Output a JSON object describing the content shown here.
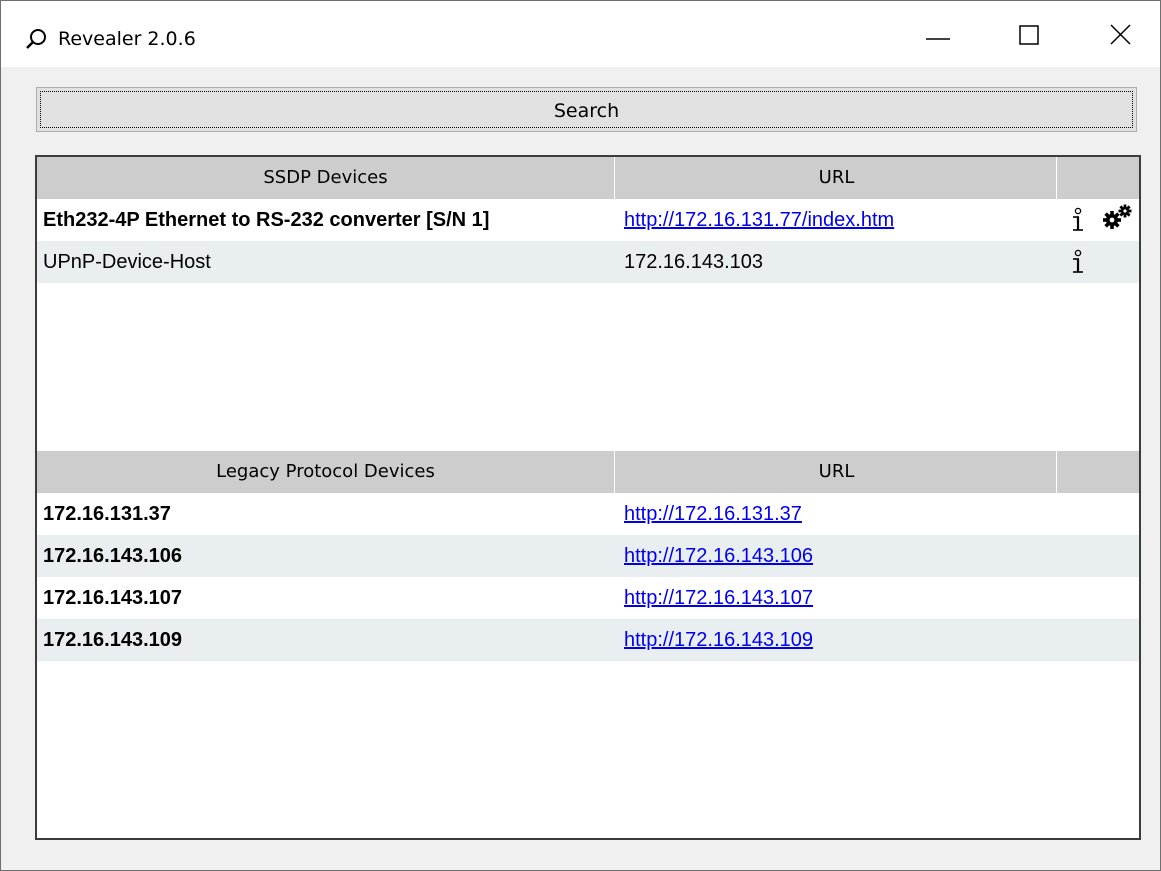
{
  "window": {
    "title": "Revealer 2.0.6",
    "app_icon": "search-icon",
    "controls": [
      "minimize-icon",
      "maximize-icon",
      "close-icon"
    ]
  },
  "search": {
    "label": "Search"
  },
  "ssdp": {
    "headers": {
      "name": "SSDP Devices",
      "url": "URL"
    },
    "rows": [
      {
        "name": "Eth232-4P Ethernet to RS-232 converter [S/N 1]",
        "url": "http://172.16.131.77/index.htm",
        "bold": true,
        "is_link": true,
        "icons": [
          "info-icon",
          "settings-gears-icon"
        ]
      },
      {
        "name": "UPnP-Device-Host",
        "url": "172.16.143.103",
        "bold": false,
        "is_link": false,
        "icons": [
          "info-icon"
        ]
      }
    ]
  },
  "legacy": {
    "headers": {
      "name": "Legacy Protocol Devices",
      "url": "URL"
    },
    "rows": [
      {
        "name": "172.16.131.37",
        "url": "http://172.16.131.37"
      },
      {
        "name": "172.16.143.106",
        "url": "http://172.16.143.106"
      },
      {
        "name": "172.16.143.107",
        "url": "http://172.16.143.107"
      },
      {
        "name": "172.16.143.109",
        "url": "http://172.16.143.109"
      }
    ]
  },
  "colors": {
    "link": "#0000ee",
    "header_bg": "#cdcdcd",
    "alt_row_bg": "#e9eef0"
  }
}
